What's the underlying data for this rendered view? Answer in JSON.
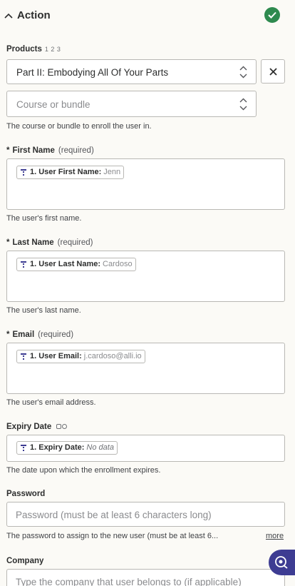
{
  "section": {
    "title": "Action",
    "status_icon": "green-check-icon",
    "status_color": "#2e8a4f"
  },
  "products": {
    "label": "Products",
    "steps": "1 2 3",
    "selected": "Part II: Embodying All Of Your Parts",
    "clear_icon": "close-icon"
  },
  "course": {
    "placeholder": "Course or bundle",
    "help": "The course or bundle to enroll the user in."
  },
  "first_name": {
    "asterisk": "*",
    "label": "First Name",
    "required": "(required)",
    "pill_label": "1. User First Name:",
    "pill_value": "Jenn",
    "help": "The user's first name."
  },
  "last_name": {
    "asterisk": "*",
    "label": "Last Name",
    "required": "(required)",
    "pill_label": "1. User Last Name:",
    "pill_value": "Cardoso",
    "help": "The user's last name."
  },
  "email": {
    "asterisk": "*",
    "label": "Email",
    "required": "(required)",
    "pill_label": "1. User Email:",
    "pill_value": "j.cardoso@alli.io",
    "help": "The user's email address."
  },
  "expiry_date": {
    "label": "Expiry Date",
    "pill_label": "1. Expiry Date:",
    "pill_value": "No data",
    "help": "The date upon which the enrollment expires."
  },
  "password": {
    "label": "Password",
    "placeholder": "Password (must be at least 6 characters long)",
    "help": "The password to assign to the new user (must be at least 6...",
    "more": "more"
  },
  "company": {
    "label": "Company",
    "placeholder": "Type the company that user belongs to (if applicable)"
  },
  "colors": {
    "accent": "#3d3c92",
    "success": "#2e8a4f",
    "border": "#b9b8b4"
  }
}
